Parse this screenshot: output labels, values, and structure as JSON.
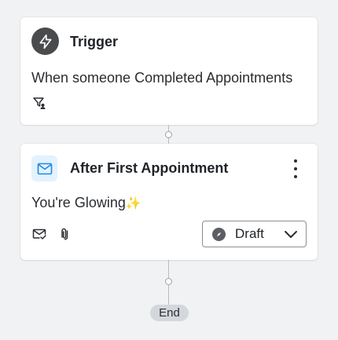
{
  "trigger": {
    "icon": "lightning-bolt-icon",
    "title": "Trigger",
    "description": "When someone Completed Appointments",
    "filter_icon": "filter-person-icon"
  },
  "action": {
    "icon": "envelope-icon",
    "title": "After First Appointment",
    "menu_icon": "kebab-menu-icon",
    "subject": "You're Glowing",
    "subject_emoji": "✨",
    "footer_icons": [
      "mail-check-icon",
      "attachment-icon"
    ],
    "status": {
      "value": "Draft",
      "icon": "compass-icon"
    }
  },
  "flow_end": {
    "label": "End"
  },
  "colors": {
    "background": "#f1f2f4",
    "trigger_icon_bg": "#4a4b4d",
    "mail_icon_bg": "#e3f2fd",
    "mail_icon_color": "#1e88e5",
    "end_pill_bg": "#d4d7dc"
  }
}
